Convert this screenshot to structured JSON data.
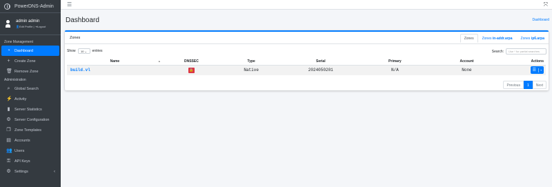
{
  "app": {
    "brand": "PowerDNS-Admin"
  },
  "user": {
    "name": "admin admin",
    "edit_profile": "Edit Profile",
    "separator": "|",
    "logout": "Logout"
  },
  "sidebar": {
    "sections": [
      {
        "header": "Zone Management",
        "items": [
          {
            "label": "Dashboard",
            "icon": "dashboard-icon",
            "active": true
          },
          {
            "label": "Create Zone",
            "icon": "plus-icon"
          },
          {
            "label": "Remove Zone",
            "icon": "trash-icon"
          }
        ]
      },
      {
        "header": "Administration",
        "items": [
          {
            "label": "Global Search",
            "icon": "search-icon"
          },
          {
            "label": "Activity",
            "icon": "activity-icon"
          },
          {
            "label": "Server Statistics",
            "icon": "bar-chart-icon"
          },
          {
            "label": "Server Configuration",
            "icon": "gear-icon"
          },
          {
            "label": "Zone Templates",
            "icon": "clone-icon"
          },
          {
            "label": "Accounts",
            "icon": "accounts-icon"
          },
          {
            "label": "Users",
            "icon": "users-icon"
          },
          {
            "label": "API Keys",
            "icon": "key-icon"
          },
          {
            "label": "Settings",
            "icon": "cog-icon",
            "has_submenu": true
          }
        ]
      }
    ]
  },
  "header": {
    "title": "Dashboard",
    "breadcrumb": "Dashboard"
  },
  "card": {
    "title": "Zones",
    "tabs": [
      {
        "plain": "Zones",
        "bold": "",
        "active": true
      },
      {
        "plain": "Zones ",
        "bold": "in-addr.arpa"
      },
      {
        "plain": "Zones ",
        "bold": "ip6.arpa"
      }
    ],
    "show_label": "Show",
    "show_value": "10",
    "entries_label": "entries",
    "search_label": "Search:",
    "search_placeholder": "Use * for partial searches"
  },
  "table": {
    "columns": [
      "Name",
      "DNSSEC",
      "Type",
      "Serial",
      "Primary",
      "Account",
      "Actions"
    ],
    "rows": [
      {
        "name": "build.vl",
        "type": "Native",
        "serial": "2024050201",
        "primary": "N/A",
        "account": "None"
      }
    ]
  },
  "pagination": {
    "previous": "Previous",
    "page": "1",
    "next": "Next"
  },
  "colors": {
    "accent": "#007bff",
    "sidebar": "#343a40",
    "danger": "#dc3545"
  }
}
